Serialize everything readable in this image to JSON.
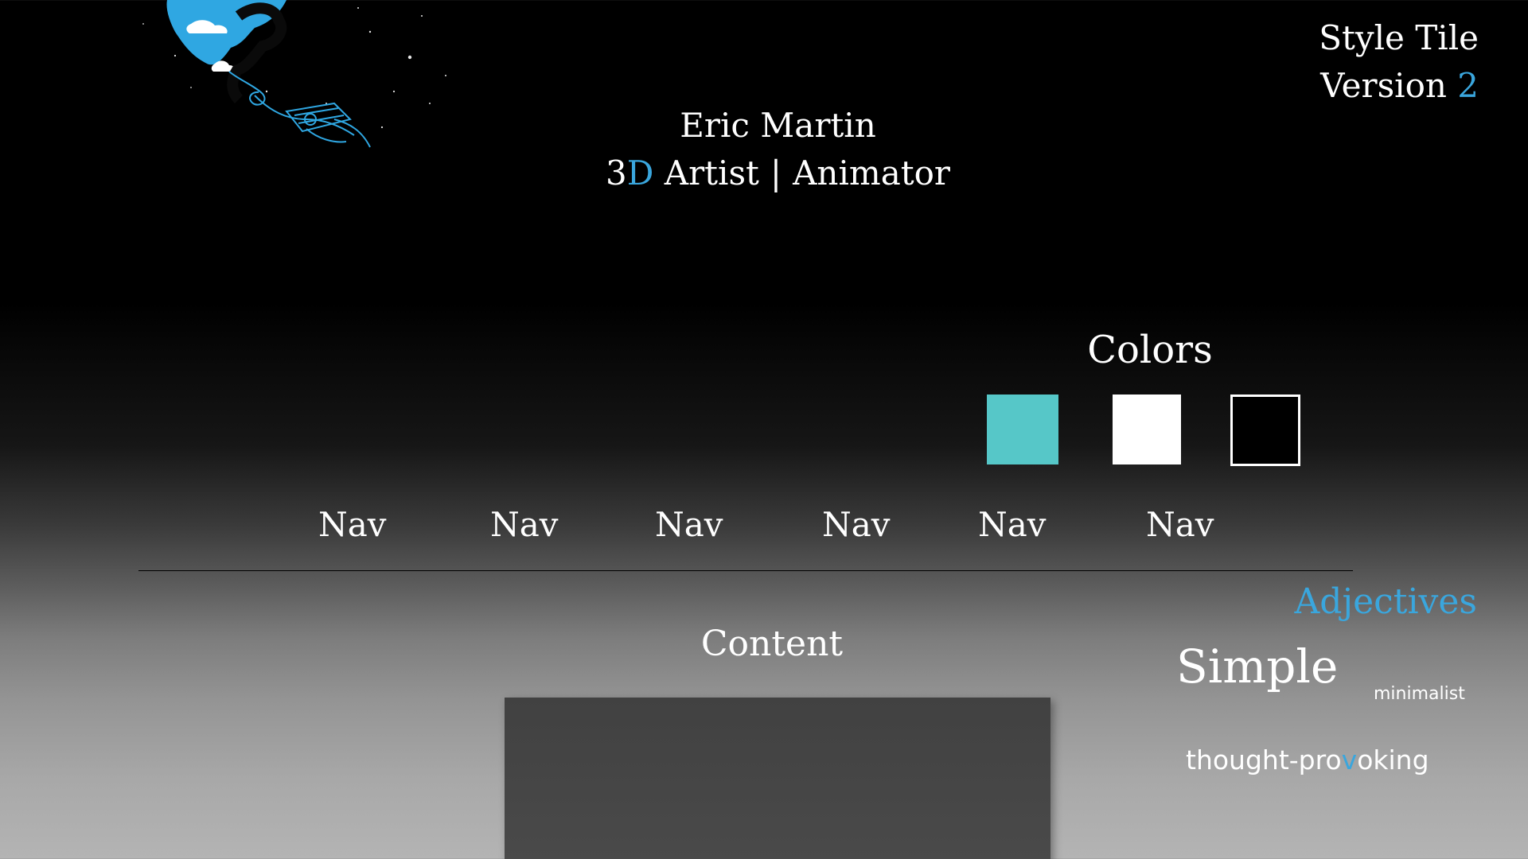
{
  "artwork": {
    "icon": "diver-in-starry-sky-artwork-icon"
  },
  "style_tile": {
    "title": "Style Tile",
    "version_label": "Version",
    "version_number": "2"
  },
  "header": {
    "name": "Eric Martin",
    "role_prefix": "3",
    "role_prefix_accent": "D",
    "role_rest": " Artist",
    "separator": "|",
    "role_secondary": "Animator"
  },
  "colors": {
    "title": "Colors",
    "swatches": [
      "#56c7c8",
      "#ffffff",
      "#000000"
    ]
  },
  "nav": {
    "items": [
      {
        "label": "Nav"
      },
      {
        "label": "Nav"
      },
      {
        "label": "Nav"
      },
      {
        "label": "Nav"
      },
      {
        "label": "Nav"
      },
      {
        "label": "Nav"
      }
    ]
  },
  "content": {
    "title": "Content"
  },
  "adjectives": {
    "title": "Adjectives",
    "primary": "Simple",
    "secondary": "minimalist",
    "tertiary_start": "thought-pro",
    "tertiary_accent": "v",
    "tertiary_end": "oking"
  },
  "theme": {
    "accent": "#3aa6dd",
    "teal": "#56c7c8",
    "text": "#ffffff"
  }
}
